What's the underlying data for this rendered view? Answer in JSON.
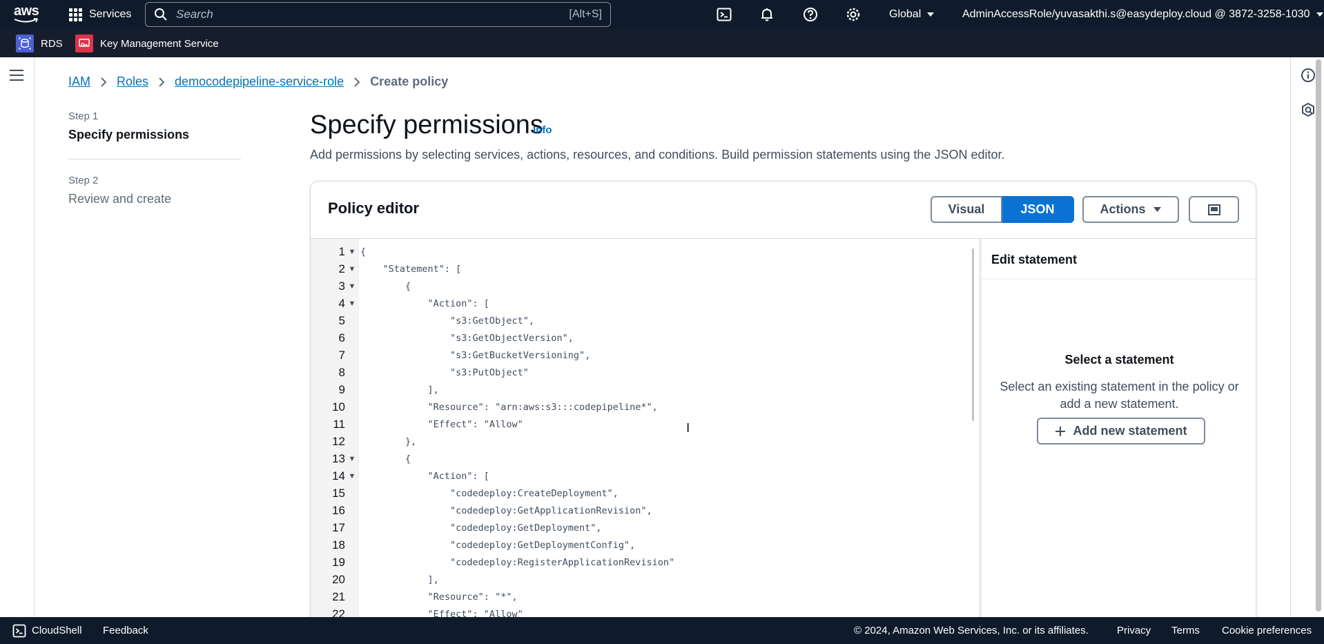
{
  "topnav": {
    "logo_text": "aws",
    "services_label": "Services",
    "search_placeholder": "Search",
    "search_shortcut": "[Alt+S]",
    "region": "Global",
    "account": "AdminAccessRole/yuvasakthi.s@easydeploy.cloud @ 3872-3258-1030"
  },
  "favorites": [
    {
      "label": "RDS",
      "icon": "rds-icon",
      "color": "#4b5fd6"
    },
    {
      "label": "Key Management Service",
      "icon": "kms-icon",
      "color": "#dd344c"
    }
  ],
  "breadcrumb": {
    "items": [
      "IAM",
      "Roles",
      "democodepipeline-service-role"
    ],
    "current": "Create policy"
  },
  "steps": [
    {
      "number": "Step 1",
      "title": "Specify permissions",
      "active": true
    },
    {
      "number": "Step 2",
      "title": "Review and create",
      "active": false
    }
  ],
  "header": {
    "title": "Specify permissions",
    "info": "Info",
    "description": "Add permissions by selecting services, actions, resources, and conditions. Build permission statements using the JSON editor."
  },
  "editor": {
    "title": "Policy editor",
    "visual_label": "Visual",
    "json_label": "JSON",
    "actions_label": "Actions",
    "lines": [
      {
        "n": "1",
        "fold": true,
        "text": "{"
      },
      {
        "n": "2",
        "fold": true,
        "text": "    \"Statement\": ["
      },
      {
        "n": "3",
        "fold": true,
        "text": "        {"
      },
      {
        "n": "4",
        "fold": true,
        "text": "            \"Action\": ["
      },
      {
        "n": "5",
        "fold": false,
        "text": "                \"s3:GetObject\","
      },
      {
        "n": "6",
        "fold": false,
        "text": "                \"s3:GetObjectVersion\","
      },
      {
        "n": "7",
        "fold": false,
        "text": "                \"s3:GetBucketVersioning\","
      },
      {
        "n": "8",
        "fold": false,
        "text": "                \"s3:PutObject\""
      },
      {
        "n": "9",
        "fold": false,
        "text": "            ],"
      },
      {
        "n": "10",
        "fold": false,
        "text": "            \"Resource\": \"arn:aws:s3:::codepipeline*\","
      },
      {
        "n": "11",
        "fold": false,
        "text": "            \"Effect\": \"Allow\""
      },
      {
        "n": "12",
        "fold": false,
        "text": "        },"
      },
      {
        "n": "13",
        "fold": true,
        "text": "        {"
      },
      {
        "n": "14",
        "fold": true,
        "text": "            \"Action\": ["
      },
      {
        "n": "15",
        "fold": false,
        "text": "                \"codedeploy:CreateDeployment\","
      },
      {
        "n": "16",
        "fold": false,
        "text": "                \"codedeploy:GetApplicationRevision\","
      },
      {
        "n": "17",
        "fold": false,
        "text": "                \"codedeploy:GetDeployment\","
      },
      {
        "n": "18",
        "fold": false,
        "text": "                \"codedeploy:GetDeploymentConfig\","
      },
      {
        "n": "19",
        "fold": false,
        "text": "                \"codedeploy:RegisterApplicationRevision\""
      },
      {
        "n": "20",
        "fold": false,
        "text": "            ],"
      },
      {
        "n": "21",
        "fold": false,
        "text": "            \"Resource\": \"*\","
      },
      {
        "n": "22",
        "fold": false,
        "text": "            \"Effect\": \"Allow\""
      }
    ]
  },
  "statement_panel": {
    "title": "Edit statement",
    "heading": "Select a statement",
    "description": "Select an existing statement in the policy or add a new statement.",
    "add_button": "Add new statement"
  },
  "footer": {
    "cloudshell": "CloudShell",
    "feedback": "Feedback",
    "copyright": "© 2024, Amazon Web Services, Inc. or its affiliates.",
    "privacy": "Privacy",
    "terms": "Terms",
    "cookies": "Cookie preferences"
  },
  "colors": {
    "nav_bg": "#0f1b2a",
    "link": "#0073bb",
    "primary": "#0972d3"
  }
}
